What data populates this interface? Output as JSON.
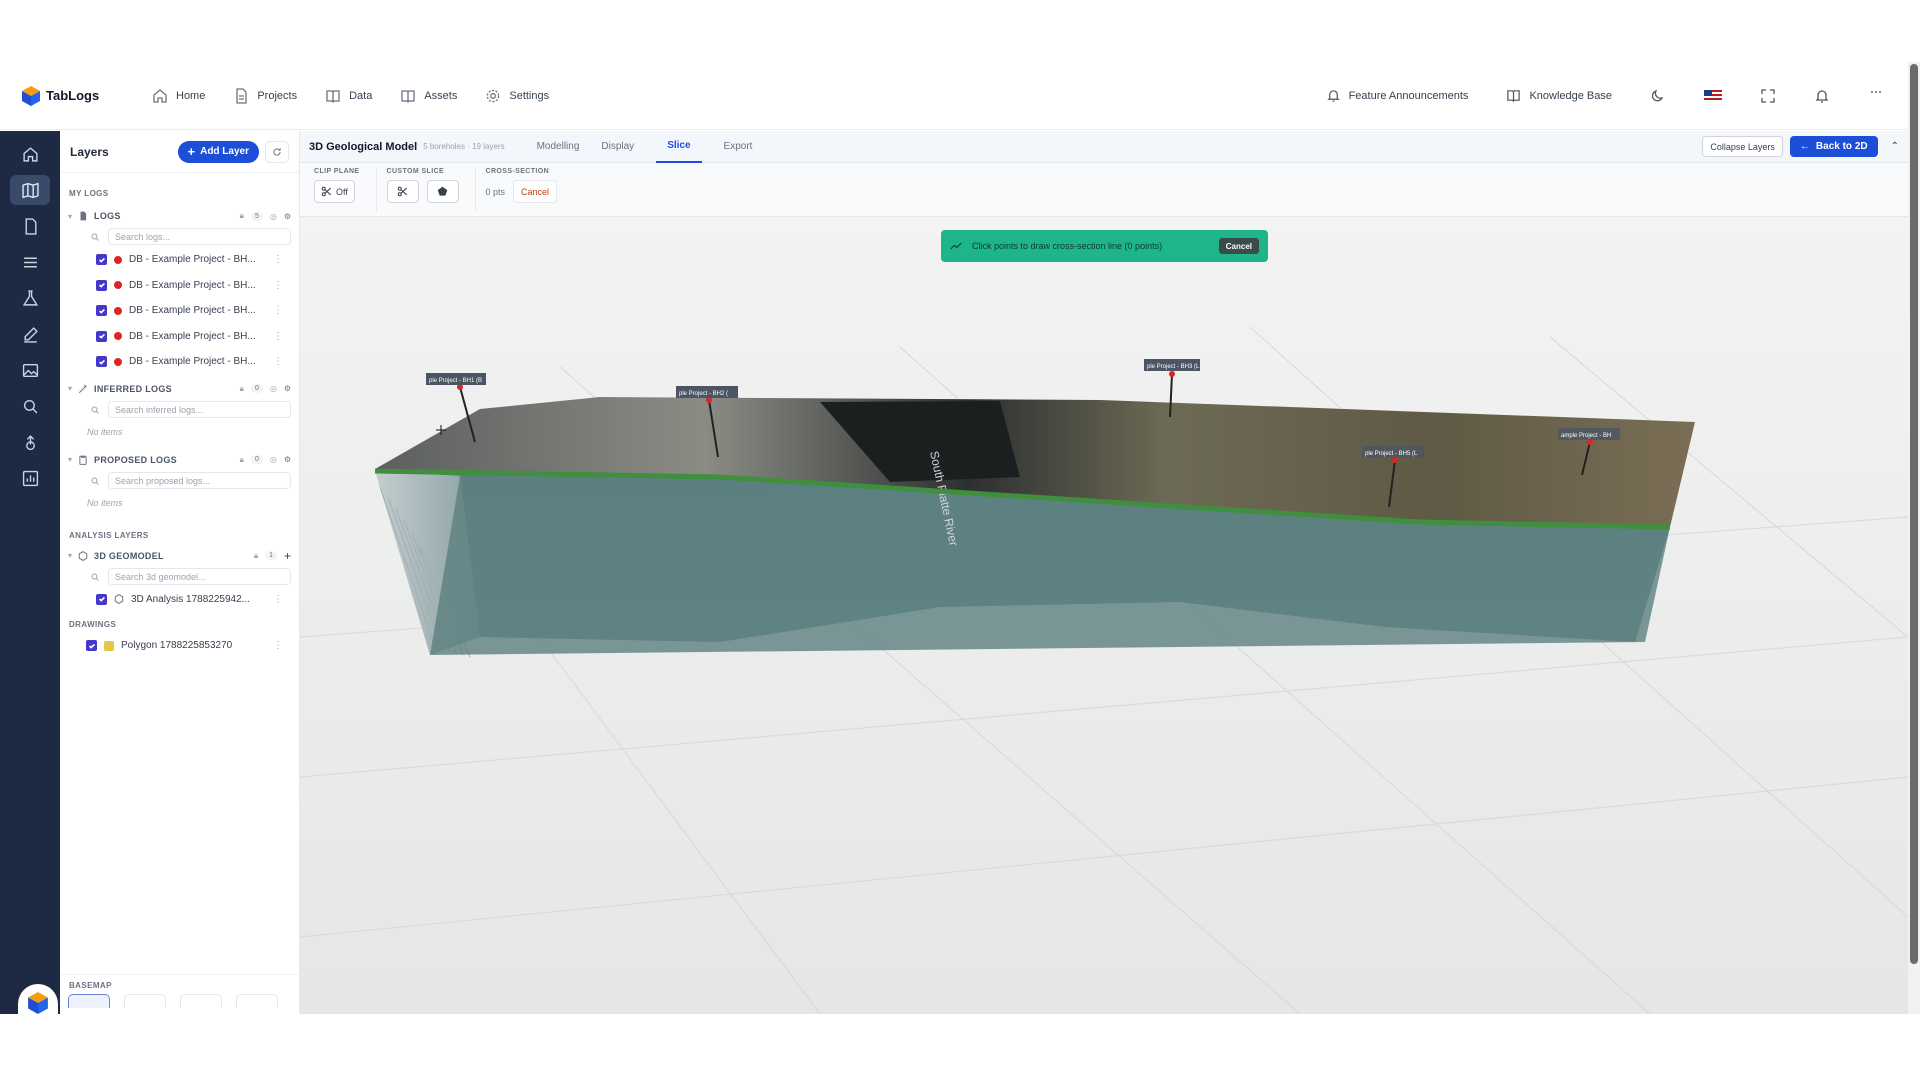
{
  "app": {
    "name": "TabLogs"
  },
  "nav": {
    "links": [
      {
        "label": "Home",
        "icon": "home-icon"
      },
      {
        "label": "Projects",
        "icon": "document-icon"
      },
      {
        "label": "Data",
        "icon": "book-icon"
      },
      {
        "label": "Assets",
        "icon": "book-open-icon"
      },
      {
        "label": "Settings",
        "icon": "gear-icon"
      }
    ],
    "feature_announcements": "Feature Announcements",
    "knowledge_base": "Knowledge Base"
  },
  "layers_panel": {
    "title": "Layers",
    "add_layer": "Add Layer",
    "my_logs_label": "MY LOGS",
    "logs": {
      "name": "LOGS",
      "count": "5",
      "search_placeholder": "Search logs...",
      "items": [
        "DB - Example Project - BH...",
        "DB - Example Project - BH...",
        "DB - Example Project - BH...",
        "DB - Example Project - BH...",
        "DB - Example Project - BH..."
      ]
    },
    "inferred_logs": {
      "name": "INFERRED LOGS",
      "count": "0",
      "search_placeholder": "Search inferred logs...",
      "empty": "No items"
    },
    "proposed_logs": {
      "name": "PROPOSED LOGS",
      "count": "0",
      "search_placeholder": "Search proposed logs...",
      "empty": "No items"
    },
    "analysis_label": "ANALYSIS LAYERS",
    "geomodel": {
      "name": "3D GEOMODEL",
      "count": "1",
      "search_placeholder": "Search 3d geomodel...",
      "item": "3D Analysis 1788225942..."
    },
    "drawings_label": "DRAWINGS",
    "drawing_item": "Polygon 1788225853270",
    "drawing_color": "#e5c74a",
    "basemap_label": "BASEMAP"
  },
  "toolbar": {
    "title": "3D Geological Model",
    "subtitle": "5 boreholes · 19 layers",
    "tabs": [
      "Modelling",
      "Display",
      "Slice",
      "Export"
    ],
    "active_tab": "Slice",
    "collapse_layers": "Collapse Layers",
    "back_to_2d": "Back to 2D"
  },
  "slice_controls": {
    "clip_plane_label": "CLIP PLANE",
    "clip_plane_value": "Off",
    "custom_slice_label": "CUSTOM SLICE",
    "cross_section_label": "CROSS-SECTION",
    "points": "0 pts",
    "cancel": "Cancel"
  },
  "toast": {
    "message": "Click points to draw cross-section line (0 points)",
    "cancel": "Cancel",
    "color": "#1fb58a"
  },
  "model": {
    "borehole_labels": [
      "ple Project - BH1 (B",
      "ple Project - BH2 (",
      "ple Project - BH3 (L",
      "ple Project - BH5 (L",
      "ample Project - BH"
    ],
    "map_label": "South Platte River"
  },
  "colors": {
    "accent": "#1d4ed8",
    "rail": "#1e2a44",
    "checkbox": "#4338ca",
    "log_dot": "#dc2626"
  }
}
